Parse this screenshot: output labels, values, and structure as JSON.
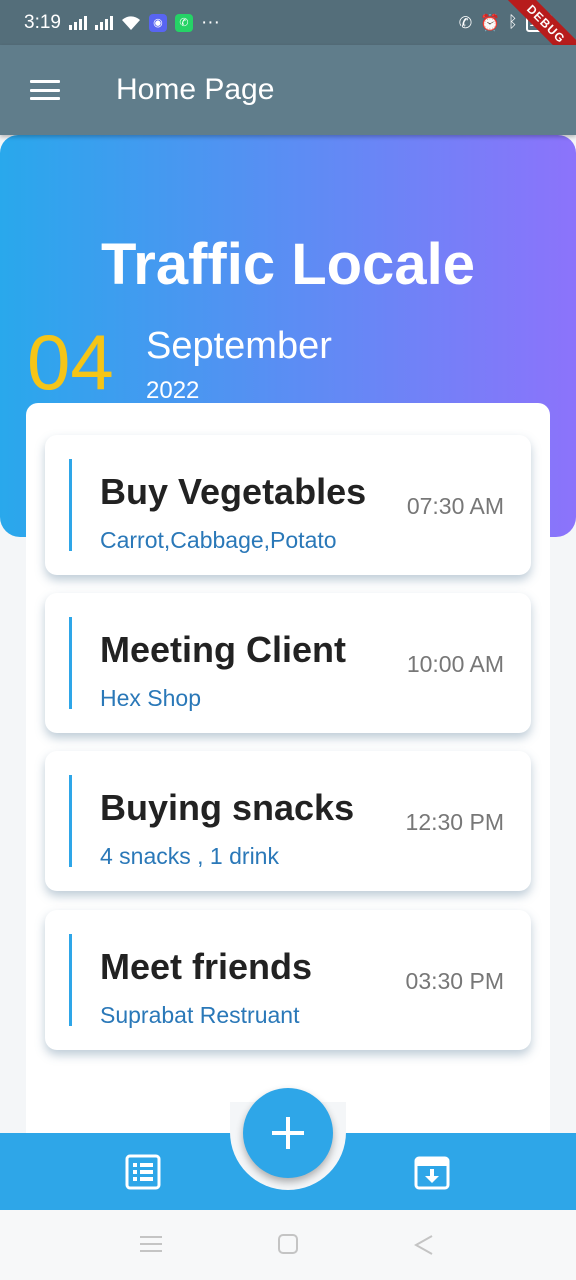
{
  "status_bar": {
    "time": "3:19",
    "more": "···",
    "battery": "100",
    "debug": "DEBUG"
  },
  "app_bar": {
    "title": "Home Page"
  },
  "header": {
    "title": "Traffic Locale",
    "day": "04",
    "month": "September",
    "year": "2022"
  },
  "tasks": [
    {
      "title": "Buy Vegetables",
      "subtitle": "Carrot,Cabbage,Potato",
      "time": "07:30 AM"
    },
    {
      "title": "Meeting Client",
      "subtitle": "Hex Shop",
      "time": "10:00 AM"
    },
    {
      "title": "Buying snacks",
      "subtitle": "4 snacks , 1 drink",
      "time": "12:30 PM"
    },
    {
      "title": "Meet friends",
      "subtitle": "Suprabat Restruant",
      "time": "03:30 PM"
    }
  ],
  "icons": {
    "menu": "menu-icon",
    "fab": "plus-icon",
    "nav_left": "list-icon",
    "nav_right": "archive-download-icon"
  },
  "colors": {
    "app_bar": "#607d8b",
    "status_bar": "#546e7a",
    "gradient_start": "#29a8ec",
    "gradient_end": "#8c73fb",
    "accent": "#2ea6e8",
    "day": "#f5c518",
    "subtitle": "#2a78b8"
  }
}
